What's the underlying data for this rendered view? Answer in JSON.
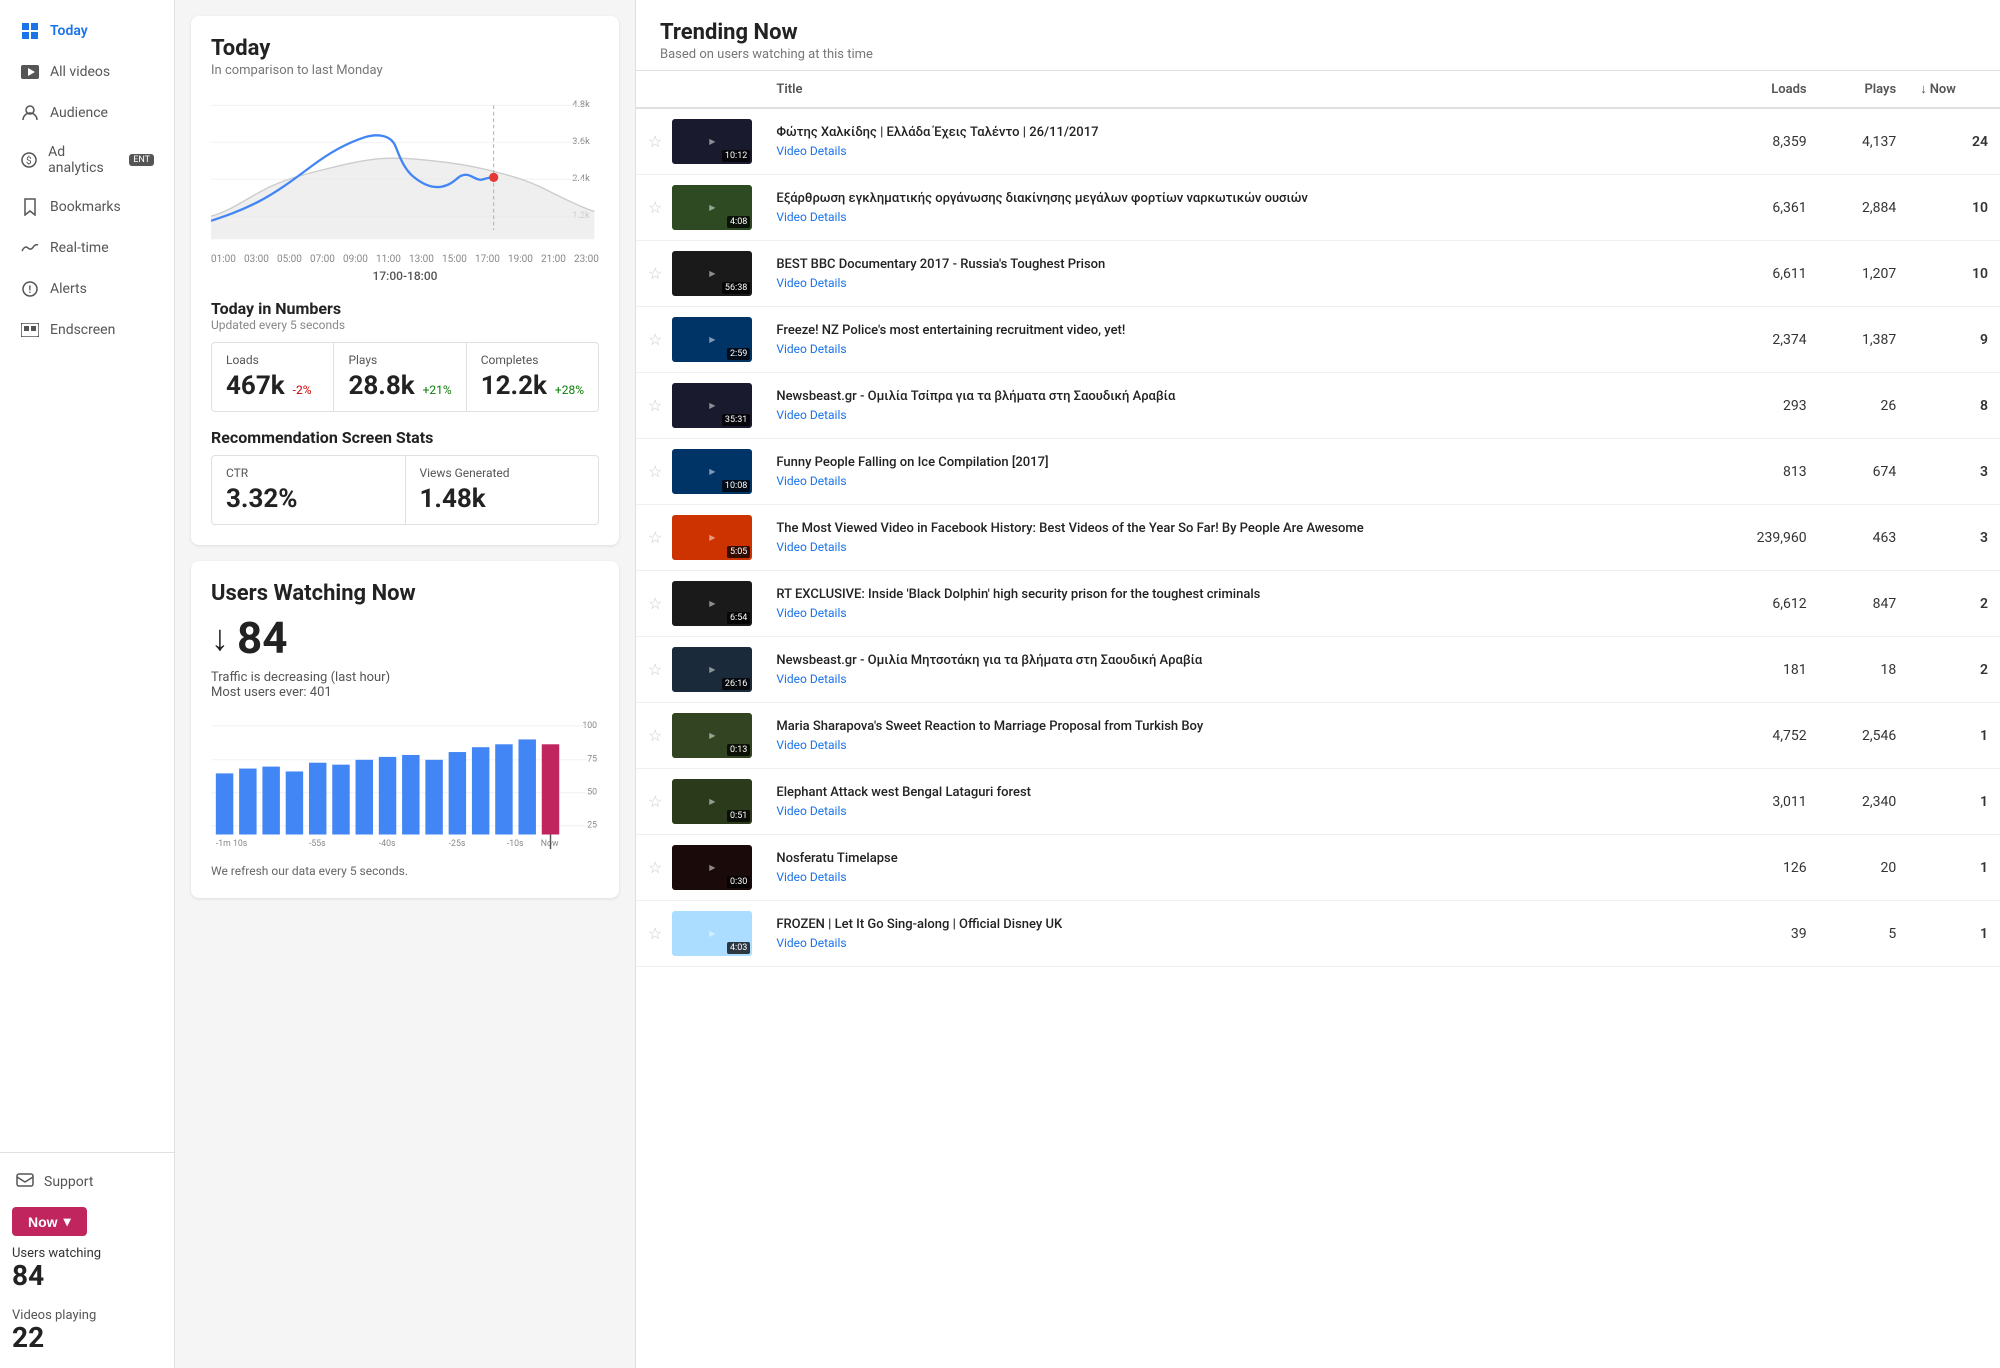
{
  "sidebar": {
    "items": [
      {
        "id": "today",
        "label": "Today",
        "icon": "⊞",
        "active": true
      },
      {
        "id": "all-videos",
        "label": "All videos",
        "icon": "🎬"
      },
      {
        "id": "audience",
        "label": "Audience",
        "icon": "☎"
      },
      {
        "id": "ad-analytics",
        "label": "Ad analytics",
        "icon": "$",
        "badge": "ENT"
      },
      {
        "id": "bookmarks",
        "label": "Bookmarks",
        "icon": "🔖"
      },
      {
        "id": "real-time",
        "label": "Real-time",
        "icon": "〰"
      },
      {
        "id": "alerts",
        "label": "Alerts",
        "icon": "ℹ"
      },
      {
        "id": "endscreen",
        "label": "Endscreen",
        "icon": "⊞"
      }
    ],
    "support_label": "Support",
    "now_button_label": "Now",
    "users_watching_label": "Users watching",
    "users_watching_value": "84",
    "videos_playing_label": "Videos playing",
    "videos_playing_value": "22"
  },
  "today_card": {
    "title": "Today",
    "subtitle": "In comparison to last Monday",
    "time_marker": "17:00-18:00",
    "y_labels": [
      "4.8k",
      "3.6k",
      "2.4k",
      "1.2k"
    ],
    "x_labels": [
      "01:00",
      "03:00",
      "05:00",
      "07:00",
      "09:00",
      "11:00",
      "13:00",
      "15:00",
      "17:00",
      "19:00",
      "21:00",
      "23:00"
    ]
  },
  "numbers": {
    "title": "Today in Numbers",
    "subtitle": "Updated every 5 seconds",
    "loads": {
      "label": "Loads",
      "value": "467k",
      "change": "-2%",
      "type": "neg"
    },
    "plays": {
      "label": "Plays",
      "value": "28.8k",
      "change": "+21%",
      "type": "pos"
    },
    "completes": {
      "label": "Completes",
      "value": "12.2k",
      "change": "+28%",
      "type": "pos"
    }
  },
  "rec_stats": {
    "title": "Recommendation Screen Stats",
    "ctr_label": "CTR",
    "ctr_value": "3.32%",
    "views_label": "Views Generated",
    "views_value": "1.48k"
  },
  "users_watching": {
    "title": "Users Watching Now",
    "count": "84",
    "traffic_desc": "Traffic is decreasing (last hour)",
    "most_ever_label": "Most users ever:",
    "most_ever_value": "401",
    "refresh_note": "We refresh our data every 5 seconds.",
    "bar_y_labels": [
      "100",
      "75",
      "50",
      "25"
    ],
    "bar_x_labels": [
      "-1m 10s",
      "-55s",
      "-40s",
      "-25s",
      "-10s",
      "Now"
    ],
    "bars": [
      55,
      60,
      62,
      58,
      65,
      63,
      68,
      70,
      72,
      68,
      75,
      80,
      84,
      90,
      84
    ]
  },
  "trending": {
    "title": "Trending Now",
    "subtitle": "Based on users watching at this time",
    "col_title": "Title",
    "col_loads": "Loads",
    "col_plays": "Plays",
    "col_now": "Now",
    "videos": [
      {
        "title": "Φώτης Χαλκίδης | Ελλάδα Έχεις Ταλέντο | 26/11/2017",
        "details_link": "Video Details",
        "duration": "10:12",
        "loads": "8,359",
        "plays": "4,137",
        "now": "24",
        "thumb_color": "#1a1a2e"
      },
      {
        "title": "Εξάρθρωση εγκληματικής οργάνωσης διακίνησης μεγάλων φορτίων ναρκωτικών ουσιών",
        "details_link": "Video Details",
        "duration": "4:08",
        "loads": "6,361",
        "plays": "2,884",
        "now": "10",
        "thumb_color": "#2d4a22"
      },
      {
        "title": "BEST BBC Documentary 2017 - Russia's Toughest Prison",
        "details_link": "Video Details",
        "duration": "56:38",
        "loads": "6,611",
        "plays": "1,207",
        "now": "10",
        "thumb_color": "#1a1a1a"
      },
      {
        "title": "Freeze! NZ Police's most entertaining recruitment video, yet!",
        "details_link": "Video Details",
        "duration": "2:59",
        "loads": "2,374",
        "plays": "1,387",
        "now": "9",
        "thumb_color": "#003366"
      },
      {
        "title": "Newsbeast.gr - Ομιλία Τσίπρα για τα βλήματα στη Σαουδική Αραβία",
        "details_link": "Video Details",
        "duration": "35:31",
        "loads": "293",
        "plays": "26",
        "now": "8",
        "thumb_color": "#1a1a2e"
      },
      {
        "title": "Funny People Falling on Ice Compilation [2017]",
        "details_link": "Video Details",
        "duration": "10:08",
        "loads": "813",
        "plays": "674",
        "now": "3",
        "thumb_color": "#003366"
      },
      {
        "title": "The Most Viewed Video in Facebook History: Best Videos of the Year So Far! By People Are Awesome",
        "details_link": "Video Details",
        "duration": "5:05",
        "loads": "239,960",
        "plays": "463",
        "now": "3",
        "thumb_color": "#cc3300"
      },
      {
        "title": "RT EXCLUSIVE: Inside 'Black Dolphin' high security prison for the toughest criminals",
        "details_link": "Video Details",
        "duration": "6:54",
        "loads": "6,612",
        "plays": "847",
        "now": "2",
        "thumb_color": "#1a1a1a"
      },
      {
        "title": "Newsbeast.gr - Ομιλία Μητσοτάκη για τα βλήματα στη Σαουδική Αραβία",
        "details_link": "Video Details",
        "duration": "26:16",
        "loads": "181",
        "plays": "18",
        "now": "2",
        "thumb_color": "#1a2a3a"
      },
      {
        "title": "Maria Sharapova's Sweet Reaction to Marriage Proposal from Turkish Boy",
        "details_link": "Video Details",
        "duration": "0:13",
        "loads": "4,752",
        "plays": "2,546",
        "now": "1",
        "thumb_color": "#334422"
      },
      {
        "title": "Elephant Attack west Bengal Lataguri forest",
        "details_link": "Video Details",
        "duration": "0:51",
        "loads": "3,011",
        "plays": "2,340",
        "now": "1",
        "thumb_color": "#2a3a1a"
      },
      {
        "title": "Nosferatu Timelapse",
        "details_link": "Video Details",
        "duration": "0:30",
        "loads": "126",
        "plays": "20",
        "now": "1",
        "thumb_color": "#1a0a0a"
      },
      {
        "title": "FROZEN | Let It Go Sing-along | Official Disney UK",
        "details_link": "Video Details",
        "duration": "4:03",
        "loads": "39",
        "plays": "5",
        "now": "1",
        "thumb_color": "#aaddff"
      }
    ]
  }
}
